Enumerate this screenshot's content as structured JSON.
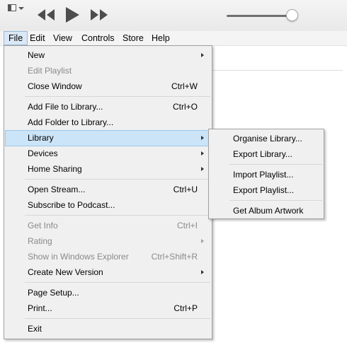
{
  "menubar": {
    "items": [
      {
        "label": "File"
      },
      {
        "label": "Edit"
      },
      {
        "label": "View"
      },
      {
        "label": "Controls"
      },
      {
        "label": "Store"
      },
      {
        "label": "Help"
      }
    ]
  },
  "toolbar": {
    "icons": [
      "window-menu-icon",
      "rewind-icon",
      "play-icon",
      "fast-forward-icon"
    ],
    "volume_level": 0.9
  },
  "file_menu": {
    "items": [
      {
        "label": "New",
        "shortcut": "",
        "submenu": true,
        "disabled": false
      },
      {
        "label": "Edit Playlist",
        "shortcut": "",
        "submenu": false,
        "disabled": true
      },
      {
        "label": "Close Window",
        "shortcut": "Ctrl+W",
        "submenu": false,
        "disabled": false
      },
      {
        "label": "Add File to Library...",
        "shortcut": "Ctrl+O",
        "submenu": false,
        "disabled": false
      },
      {
        "label": "Add Folder to Library...",
        "shortcut": "",
        "submenu": false,
        "disabled": false
      },
      {
        "label": "Library",
        "shortcut": "",
        "submenu": true,
        "disabled": false,
        "highlighted": true
      },
      {
        "label": "Devices",
        "shortcut": "",
        "submenu": true,
        "disabled": false
      },
      {
        "label": "Home Sharing",
        "shortcut": "",
        "submenu": true,
        "disabled": false
      },
      {
        "label": "Open Stream...",
        "shortcut": "Ctrl+U",
        "submenu": false,
        "disabled": false
      },
      {
        "label": "Subscribe to Podcast...",
        "shortcut": "",
        "submenu": false,
        "disabled": false
      },
      {
        "label": "Get Info",
        "shortcut": "Ctrl+I",
        "submenu": false,
        "disabled": true
      },
      {
        "label": "Rating",
        "shortcut": "",
        "submenu": true,
        "disabled": true
      },
      {
        "label": "Show in Windows Explorer",
        "shortcut": "Ctrl+Shift+R",
        "submenu": false,
        "disabled": true
      },
      {
        "label": "Create New Version",
        "shortcut": "",
        "submenu": true,
        "disabled": false
      },
      {
        "label": "Page Setup...",
        "shortcut": "",
        "submenu": false,
        "disabled": false
      },
      {
        "label": "Print...",
        "shortcut": "Ctrl+P",
        "submenu": false,
        "disabled": false
      },
      {
        "label": "Exit",
        "shortcut": "",
        "submenu": false,
        "disabled": false
      }
    ]
  },
  "library_menu": {
    "items": [
      {
        "label": "Organise Library..."
      },
      {
        "label": "Export Library..."
      },
      {
        "label": "Import Playlist..."
      },
      {
        "label": "Export Playlist..."
      },
      {
        "label": "Get Album Artwork"
      }
    ]
  }
}
